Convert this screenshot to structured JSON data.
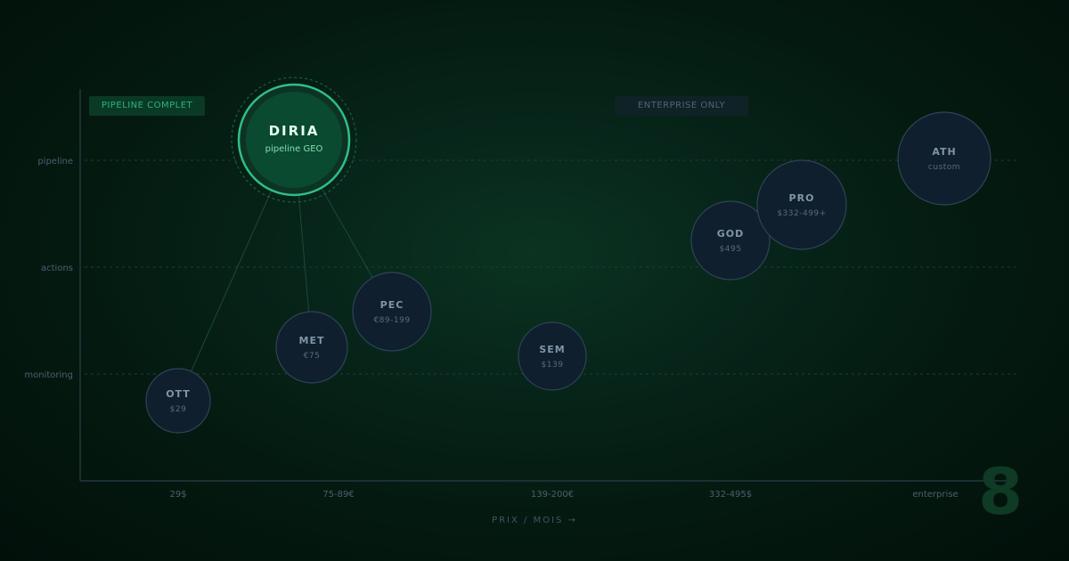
{
  "badges": {
    "left": "PIPELINE COMPLET",
    "right": "ENTERPRISE ONLY"
  },
  "x_axis_title": "PRIX / MOIS →",
  "watermark": "8",
  "colors": {
    "highlight": "#2fbf85",
    "highlight_fill": "#0a4a30",
    "bubble_fill": "#0f1f2e",
    "bubble_stroke": "#2e4456",
    "label": "#7f95a8",
    "sub": "#566b7e"
  },
  "chart_data": {
    "type": "scatter",
    "title": "",
    "xlabel": "PRIX / MOIS →",
    "ylabel": "",
    "x_categories": [
      "29$",
      "75-89€",
      "139-200€",
      "332-495$",
      "enterprise"
    ],
    "y_categories": [
      "monitoring",
      "actions",
      "pipeline"
    ],
    "grid": true,
    "points": [
      {
        "name": "DIRIA",
        "sub": "pipeline GEO",
        "x": "75-89€",
        "y": "pipeline",
        "highlight": true
      },
      {
        "name": "OTT",
        "sub": "$29",
        "x": "29$",
        "y": "monitoring"
      },
      {
        "name": "MET",
        "sub": "€75",
        "x": "75-89€",
        "y": "monitoring"
      },
      {
        "name": "PEC",
        "sub": "€89-199",
        "x": "75-89€",
        "y": "actions"
      },
      {
        "name": "SEM",
        "sub": "$139",
        "x": "139-200€",
        "y": "monitoring"
      },
      {
        "name": "GOD",
        "sub": "$495",
        "x": "332-495$",
        "y": "actions"
      },
      {
        "name": "PRO",
        "sub": "$332-499+",
        "x": "332-495$",
        "y": "pipeline"
      },
      {
        "name": "ATH",
        "sub": "custom",
        "x": "enterprise",
        "y": "pipeline"
      }
    ],
    "connections": [
      [
        "DIRIA",
        "OTT"
      ],
      [
        "DIRIA",
        "MET"
      ],
      [
        "DIRIA",
        "PEC"
      ]
    ]
  }
}
